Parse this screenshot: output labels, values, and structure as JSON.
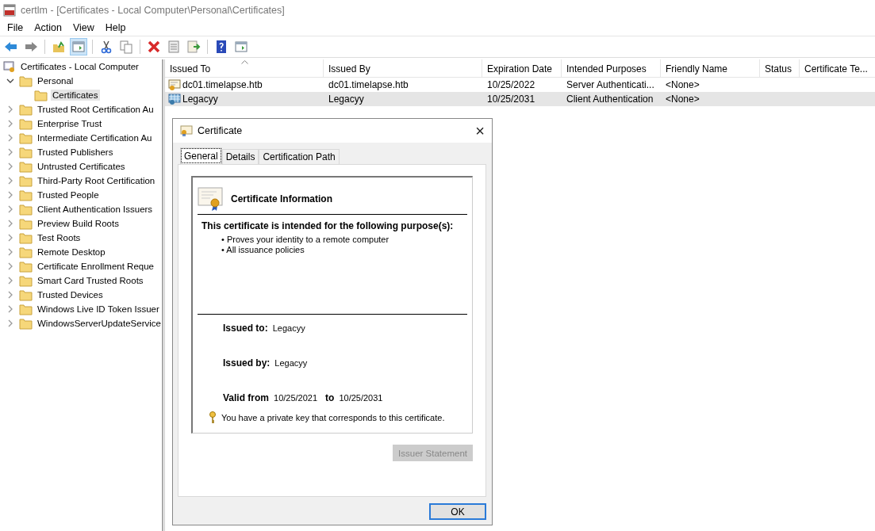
{
  "window": {
    "title": "certlm - [Certificates - Local Computer\\Personal\\Certificates]"
  },
  "menu": [
    "File",
    "Action",
    "View",
    "Help"
  ],
  "toolbar": [
    {
      "pressed": false
    },
    {
      "pressed": false
    },
    {
      "pressed": false
    },
    {
      "pressed": true
    },
    {
      "pressed": false
    },
    {
      "pressed": false
    },
    {
      "pressed": false
    },
    {
      "pressed": false
    },
    {
      "pressed": false
    },
    {
      "pressed": false
    },
    {
      "pressed": false
    }
  ],
  "tree": {
    "label": "Certificates - Local Computer",
    "selected": false,
    "children": [
      {
        "label": "Personal",
        "expanded": true,
        "selected": false,
        "children": [
          {
            "label": "Certificates",
            "selected": true
          }
        ]
      },
      {
        "label": "Trusted Root Certification Au",
        "expanded": false,
        "selected": false
      },
      {
        "label": "Enterprise Trust",
        "expanded": false,
        "selected": false
      },
      {
        "label": "Intermediate Certification Au",
        "expanded": false,
        "selected": false
      },
      {
        "label": "Trusted Publishers",
        "expanded": false,
        "selected": false
      },
      {
        "label": "Untrusted Certificates",
        "expanded": false,
        "selected": false
      },
      {
        "label": "Third-Party Root Certification",
        "expanded": false,
        "selected": false
      },
      {
        "label": "Trusted People",
        "expanded": false,
        "selected": false
      },
      {
        "label": "Client Authentication Issuers",
        "expanded": false,
        "selected": false
      },
      {
        "label": "Preview Build Roots",
        "expanded": false,
        "selected": false
      },
      {
        "label": "Test Roots",
        "expanded": false,
        "selected": false
      },
      {
        "label": "Remote Desktop",
        "expanded": false,
        "selected": false
      },
      {
        "label": "Certificate Enrollment Reque",
        "expanded": false,
        "selected": false
      },
      {
        "label": "Smart Card Trusted Roots",
        "expanded": false,
        "selected": false
      },
      {
        "label": "Trusted Devices",
        "expanded": false,
        "selected": false
      },
      {
        "label": "Windows Live ID Token Issuer",
        "expanded": false,
        "selected": false
      },
      {
        "label": "WindowsServerUpdateService",
        "expanded": false,
        "selected": false
      }
    ]
  },
  "table": {
    "columns": [
      "Issued To",
      "Issued By",
      "Expiration Date",
      "Intended Purposes",
      "Friendly Name",
      "Status",
      "Certificate Te..."
    ],
    "rows": [
      {
        "selected": false,
        "cells": [
          "dc01.timelapse.htb",
          "dc01.timelapse.htb",
          "10/25/2022",
          "Server Authenticati...",
          "<None>",
          "",
          ""
        ]
      },
      {
        "selected": true,
        "cells": [
          "Legacyy",
          "Legacyy",
          "10/25/2031",
          "Client Authentication",
          "<None>",
          "",
          ""
        ]
      }
    ]
  },
  "dialog": {
    "title": "Certificate",
    "close": "×",
    "tabs": [
      {
        "label": "General",
        "selected": true
      },
      {
        "label": "Details",
        "selected": false
      },
      {
        "label": "Certification Path",
        "selected": false
      }
    ],
    "heading": "Certificate Information",
    "purpose_title": "This certificate is intended for the following purpose(s):",
    "purposes": [
      "• Proves your identity to a remote computer",
      "• All issuance policies"
    ],
    "issued_to_label": "Issued to:",
    "issued_to": "Legacyy",
    "issued_by_label": "Issued by:",
    "issued_by": "Legacyy",
    "valid_from_label": "Valid from",
    "valid_from": "10/25/2021",
    "valid_to_label": "to",
    "valid_to": "10/25/2031",
    "key_note": "You have a private key that corresponds to this certificate.",
    "issuer_statement": {
      "label": "Issuer Statement",
      "disabled": true
    },
    "ok": "OK"
  }
}
